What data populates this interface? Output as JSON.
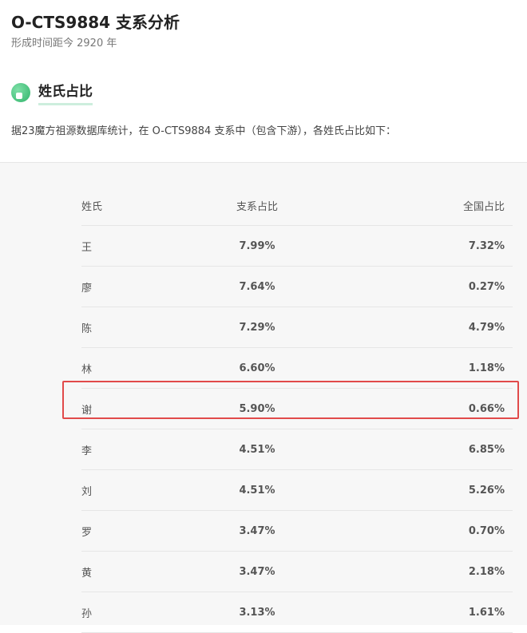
{
  "header": {
    "title": "O-CTS9884 支系分析",
    "subtitle": "形成时间距今 2920 年"
  },
  "section": {
    "title": "姓氏占比",
    "description": "据23魔方祖源数据库统计，在 O-CTS9884 支系中（包含下游），各姓氏占比如下："
  },
  "table": {
    "columns": [
      "姓氏",
      "支系占比",
      "全国占比"
    ],
    "rows": [
      {
        "surname": "王",
        "branch": "7.99%",
        "national": "7.32%"
      },
      {
        "surname": "廖",
        "branch": "7.64%",
        "national": "0.27%"
      },
      {
        "surname": "陈",
        "branch": "7.29%",
        "national": "4.79%"
      },
      {
        "surname": "林",
        "branch": "6.60%",
        "national": "1.18%"
      },
      {
        "surname": "谢",
        "branch": "5.90%",
        "national": "0.66%"
      },
      {
        "surname": "李",
        "branch": "4.51%",
        "national": "6.85%"
      },
      {
        "surname": "刘",
        "branch": "4.51%",
        "national": "5.26%"
      },
      {
        "surname": "罗",
        "branch": "3.47%",
        "national": "0.70%"
      },
      {
        "surname": "黄",
        "branch": "3.47%",
        "national": "2.18%"
      },
      {
        "surname": "孙",
        "branch": "3.13%",
        "national": "1.61%"
      }
    ],
    "highlighted_row": "谢"
  },
  "colors": {
    "highlight_border": "#e14a4a",
    "table_background": "#f7f7f7",
    "accent": "#2fb36a"
  }
}
